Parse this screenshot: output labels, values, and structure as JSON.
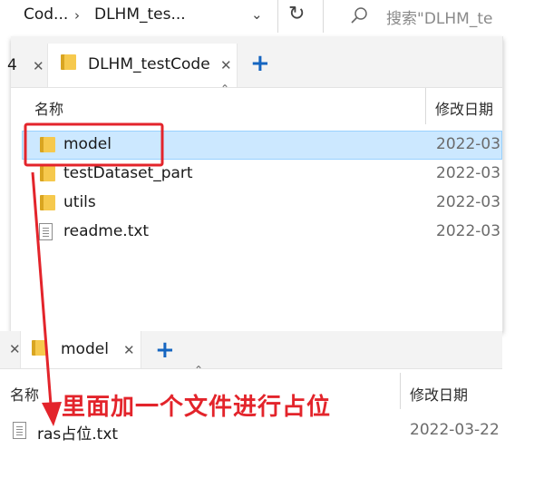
{
  "address_bar": {
    "crumbs": [
      "Cod...",
      "DLHM_tes..."
    ],
    "search_placeholder": "搜索\"DLHM_te"
  },
  "window1": {
    "left_tab_partial": "4",
    "tab_label": "DLHM_testCode",
    "columns": {
      "name": "名称",
      "modified": "修改日期"
    },
    "rows": [
      {
        "name": "model",
        "date": "2022-03",
        "type": "folder",
        "selected": true
      },
      {
        "name": "testDataset_part",
        "date": "2022-03",
        "type": "folder",
        "selected": false
      },
      {
        "name": "utils",
        "date": "2022-03",
        "type": "folder",
        "selected": false
      },
      {
        "name": "readme.txt",
        "date": "2022-03",
        "type": "file",
        "selected": false
      }
    ]
  },
  "window2": {
    "tab_label": "model",
    "columns": {
      "name": "名称",
      "modified": "修改日期"
    },
    "rows": [
      {
        "name": "ras占位.txt",
        "date": "2022-03-22",
        "type": "file"
      }
    ]
  },
  "annotation": {
    "text": "里面加一个文件进行占位",
    "color": "#e3242b"
  }
}
